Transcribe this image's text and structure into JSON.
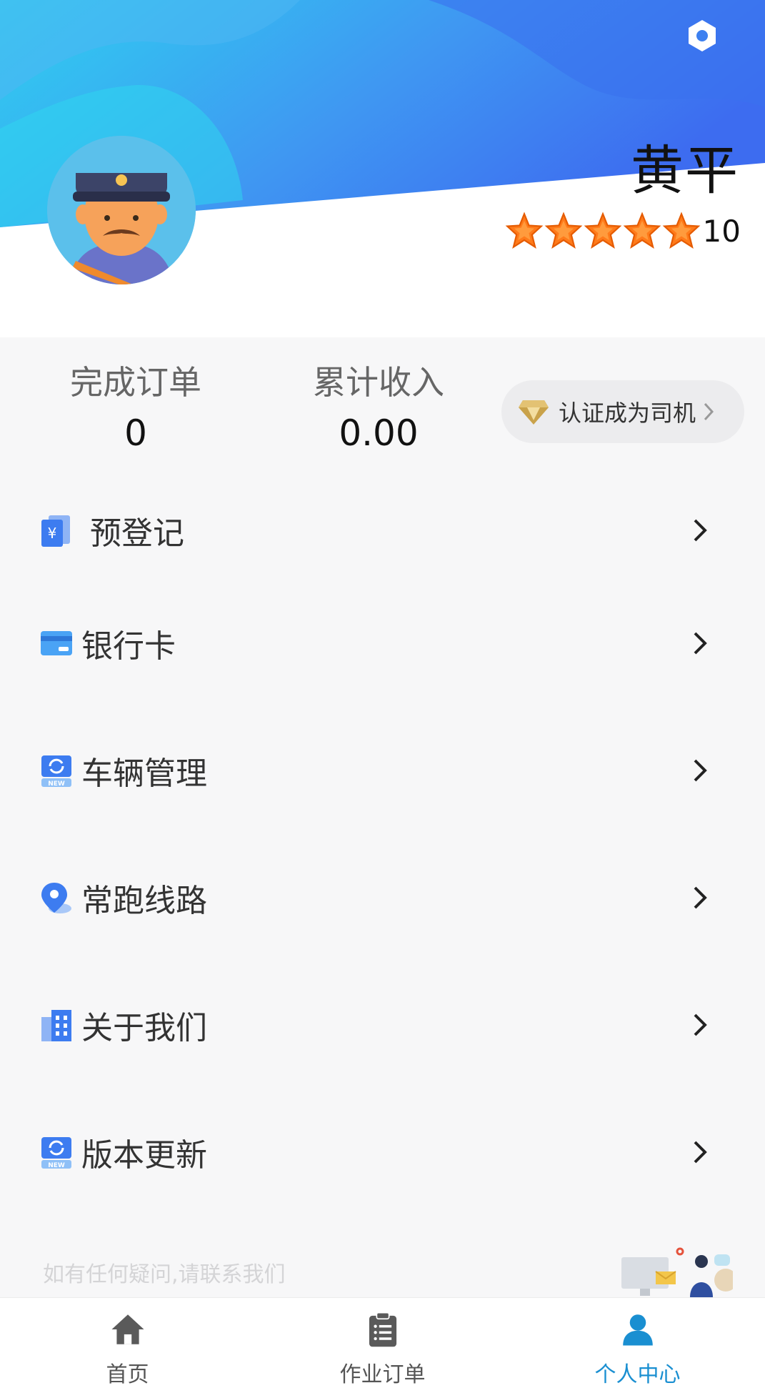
{
  "profile": {
    "name": "黄平",
    "rating_score": "10",
    "stars": 5
  },
  "stats": {
    "orders_label": "完成订单",
    "orders_value": "0",
    "income_label": "累计收入",
    "income_value": "0.00",
    "certify_label": "认证成为司机"
  },
  "menu": {
    "items": [
      {
        "label": "预登记",
        "icon": "yen-card-icon"
      },
      {
        "label": "银行卡",
        "icon": "bank-card-icon"
      },
      {
        "label": "车辆管理",
        "icon": "refresh-new-icon"
      },
      {
        "label": "常跑线路",
        "icon": "location-pin-icon"
      },
      {
        "label": "关于我们",
        "icon": "building-icon"
      },
      {
        "label": "版本更新",
        "icon": "refresh-new-icon"
      }
    ]
  },
  "contact": {
    "text": "如有任何疑问,请联系我们"
  },
  "bottom_nav": {
    "items": [
      {
        "label": "首页",
        "icon": "home-icon"
      },
      {
        "label": "作业订单",
        "icon": "clipboard-list-icon"
      },
      {
        "label": "个人中心",
        "icon": "person-icon"
      }
    ],
    "active_index": 2
  },
  "colors": {
    "header_blue": "#3d8bf0",
    "header_cyan": "#2fd0f0",
    "star_orange": "#ff7a1a",
    "active_blue": "#1a8fd1",
    "nav_gray": "#555555"
  }
}
